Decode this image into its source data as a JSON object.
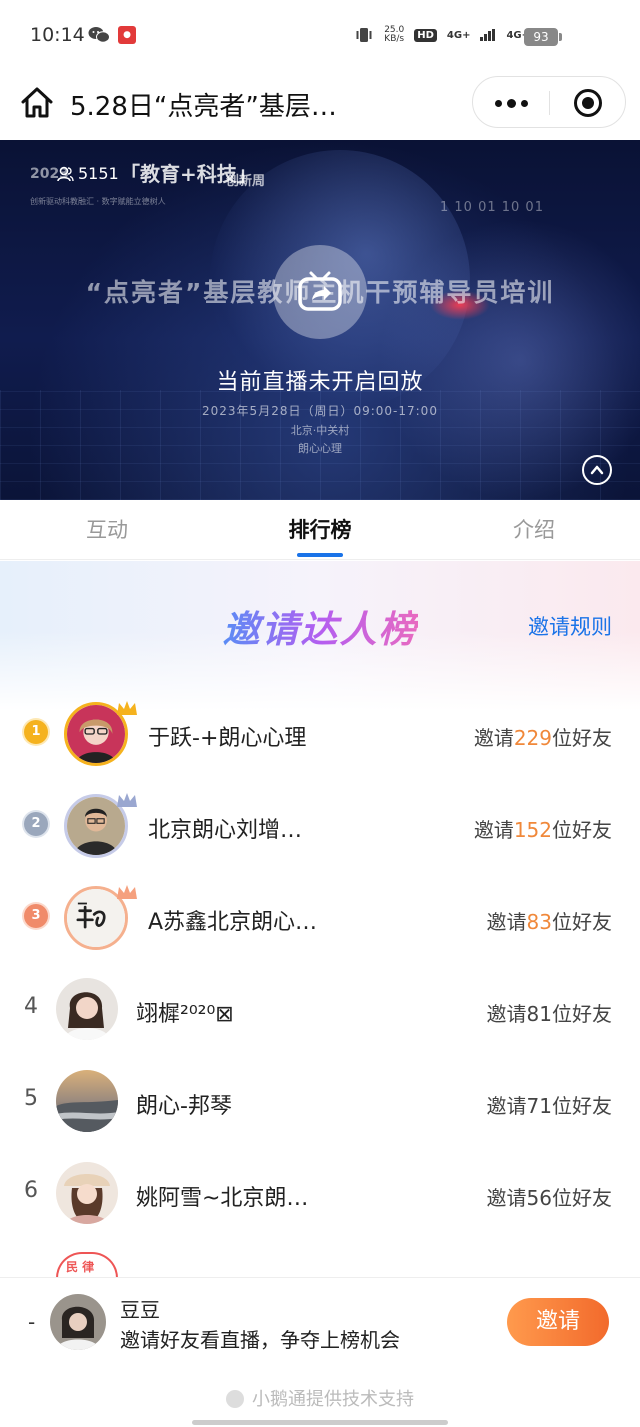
{
  "status_bar": {
    "time": "10:14",
    "speed_value": "25.0",
    "speed_unit": "KB/s",
    "hd_label": "HD",
    "network_1": "4G+",
    "network_2": "4G+",
    "battery": "93"
  },
  "header": {
    "title": "5.28日“点亮者”基层…"
  },
  "banner": {
    "viewer_count": "5151",
    "brand_year": "2023",
    "brand_title": "「教育+科技」",
    "brand_tag": "创新周",
    "brand_sub": "创新驱动科教融汇 · 数字赋能立德树人",
    "binary_text": "1 10 01 10 01",
    "event_title": "“点亮者”基层教师主机干预辅导员培训",
    "replay_message": "当前直播未开启回放",
    "date": "2023年5月28日（周日）09:00-17:00",
    "location": "北京·中关村",
    "organizer": "朗心心理"
  },
  "tabs": [
    {
      "label": "互动",
      "active": false
    },
    {
      "label": "排行榜",
      "active": true
    },
    {
      "label": "介绍",
      "active": false
    }
  ],
  "ranking": {
    "title": "邀请达人榜",
    "rules_link": "邀请规则",
    "invite_prefix": "邀请",
    "invite_suffix": "位好友",
    "rows": [
      {
        "rank": "1",
        "name": "于跃-+朗心心理",
        "count": "229",
        "medal": "gold"
      },
      {
        "rank": "2",
        "name": "北京朗心刘增…",
        "count": "152",
        "medal": "silver"
      },
      {
        "rank": "3",
        "name": "A苏鑫北京朗心…",
        "count": "83",
        "medal": "bronze"
      },
      {
        "rank": "4",
        "name": "翊樨²⁰²⁰⊠",
        "count": "81",
        "medal": "none"
      },
      {
        "rank": "5",
        "name": "朗心-邦琴",
        "count": "71",
        "medal": "none"
      },
      {
        "rank": "6",
        "name": "姚阿雪~北京朗…",
        "count": "56",
        "medal": "none"
      }
    ],
    "partial_next_avatar_text": "民 律"
  },
  "bottom_bar": {
    "my_rank": "-",
    "my_name": "豆豆",
    "tip": "邀请好友看直播，争夺上榜机会",
    "invite_button": "邀请"
  },
  "footer": {
    "text": "小鹅通提供技术支持"
  },
  "colors": {
    "accent_blue": "#1a73e8",
    "highlight_orange": "#f0883a",
    "invite_button": "#f26a2c"
  }
}
